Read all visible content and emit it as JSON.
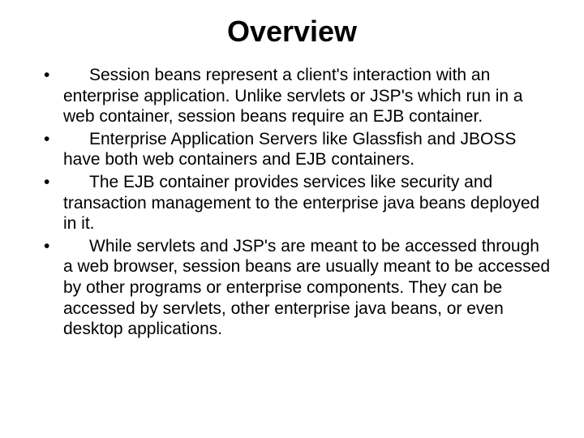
{
  "slide": {
    "title": "Overview",
    "bullets": [
      "Session beans represent a client's interaction with an enterprise application.  Unlike servlets or JSP's which run in a web container, session beans require an EJB container.",
      "Enterprise Application Servers like Glassfish and JBOSS have both web containers and EJB containers.",
      "The EJB container provides services like security and transaction management to the enterprise java beans deployed in it.",
      "While servlets and JSP's are meant to be accessed through a web browser, session beans are usually meant to be accessed by other programs or enterprise components.  They can be accessed by servlets, other enterprise java beans, or even desktop applications."
    ]
  }
}
